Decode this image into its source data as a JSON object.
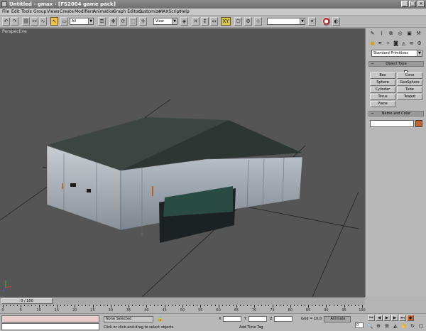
{
  "window": {
    "title": "Untitled - gmax - [FS2004 game pack]",
    "minimize": "_",
    "maximize": "□",
    "close": "×"
  },
  "menu": [
    "File",
    "Edit",
    "Tools",
    "Group",
    "Views",
    "Create",
    "Modifiers",
    "Animation",
    "Graph Editors",
    "Customize",
    "MAXScript",
    "Help"
  ],
  "toolbar": {
    "selection_filter": "All",
    "coord_system": "View",
    "named_selection": ""
  },
  "viewport": {
    "label": "Perspective"
  },
  "command_panel": {
    "object_category": "Standard Primitives",
    "object_type_rollout": "Object Type",
    "autogrid_label": "AutoGrid",
    "primitives": [
      [
        "Box",
        "Cone"
      ],
      [
        "Sphere",
        "GeoSphere"
      ],
      [
        "Cylinder",
        "Tube"
      ],
      [
        "Torus",
        "Teapot"
      ],
      [
        "Plane",
        ""
      ]
    ],
    "name_color_rollout": "Name and Color",
    "object_name": "",
    "object_color": "#c8602a"
  },
  "timeline": {
    "position": "0 / 100",
    "ticks": [
      "0",
      "5",
      "10",
      "15",
      "20",
      "25",
      "30",
      "35",
      "40",
      "45",
      "50",
      "55",
      "60",
      "65",
      "70",
      "75",
      "80",
      "85",
      "90",
      "95",
      "100"
    ]
  },
  "status": {
    "selection": "None Selected",
    "prompt": "Click or click-and-drag to select objects",
    "add_time_tag": "Add Time Tag",
    "grid": "Grid = 10.0",
    "animate": "Animate",
    "x_label": "X",
    "y_label": "Y",
    "z_label": "Z",
    "current_frame": "0"
  }
}
